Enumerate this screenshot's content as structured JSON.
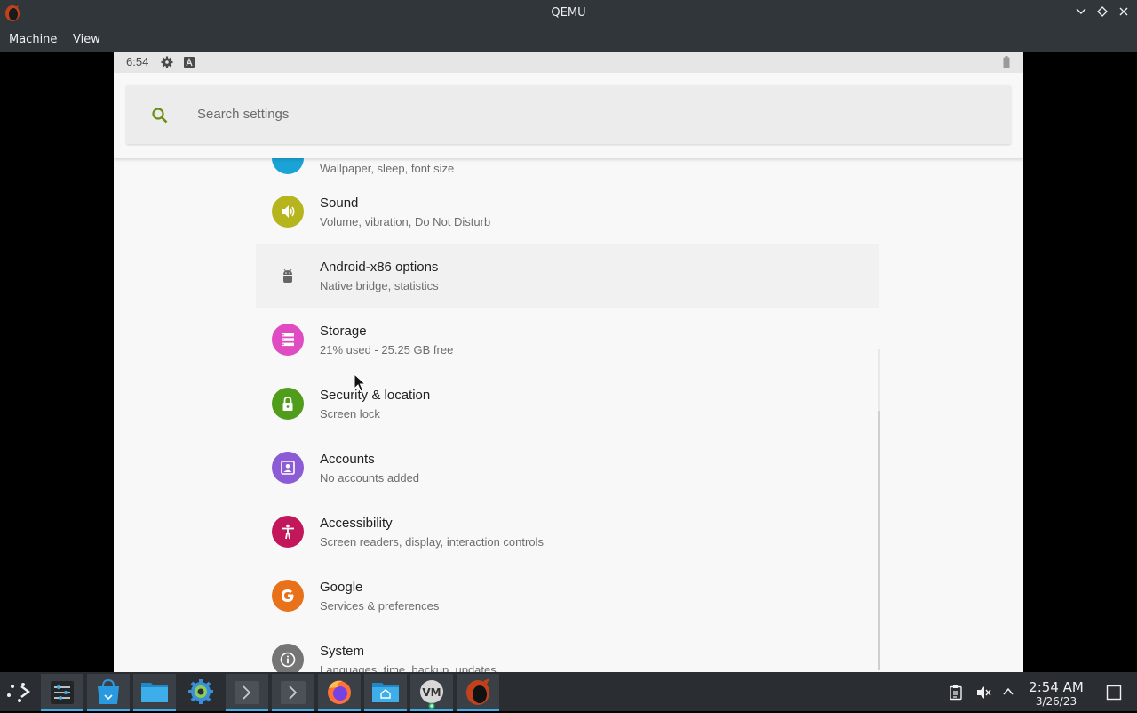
{
  "window": {
    "title": "QEMU",
    "icon": "qemu-icon",
    "controls": [
      "chevron-down-icon",
      "diamond-icon",
      "close-icon"
    ]
  },
  "menu": {
    "items": [
      "Machine",
      "View"
    ]
  },
  "android": {
    "status_time": "6:54",
    "status_icons": [
      "gear-icon",
      "keyboard-a-icon",
      "battery-icon"
    ],
    "search_placeholder": "Search settings",
    "partial_top_subtitle": "Wallpaper, sleep, font size",
    "settings": [
      {
        "title": "Sound",
        "subtitle": "Volume, vibration, Do Not Disturb",
        "color": "#b6b51d",
        "icon": "volume-icon"
      },
      {
        "title": "Android-x86 options",
        "subtitle": "Native bridge, statistics",
        "color": "#f1f1f1",
        "icon": "android-icon"
      },
      {
        "title": "Storage",
        "subtitle": "21% used - 25.25 GB free",
        "color": "#e04bc1",
        "icon": "storage-icon"
      },
      {
        "title": "Security & location",
        "subtitle": "Screen lock",
        "color": "#4f9d1a",
        "icon": "lock-icon"
      },
      {
        "title": "Accounts",
        "subtitle": "No accounts added",
        "color": "#8c5bd6",
        "icon": "account-icon"
      },
      {
        "title": "Accessibility",
        "subtitle": "Screen readers, display, interaction controls",
        "color": "#c2185b",
        "icon": "accessibility-icon"
      },
      {
        "title": "Google",
        "subtitle": "Services & preferences",
        "color": "#e8711a",
        "icon": "google-icon"
      },
      {
        "title": "System",
        "subtitle": "Languages, time, backup, updates",
        "color": "#757575",
        "icon": "info-icon"
      }
    ]
  },
  "taskbar": {
    "apps": [
      "app-launcher-icon",
      "system-settings-icon",
      "discover-store-icon",
      "dolphin-files-icon",
      "system-settings-gear-icon",
      "konsole-icon",
      "konsole-icon-2",
      "firefox-icon",
      "home-folder-icon",
      "virt-manager-icon",
      "qemu-icon"
    ],
    "clock_time": "2:54 AM",
    "clock_date": "3/26/23"
  }
}
